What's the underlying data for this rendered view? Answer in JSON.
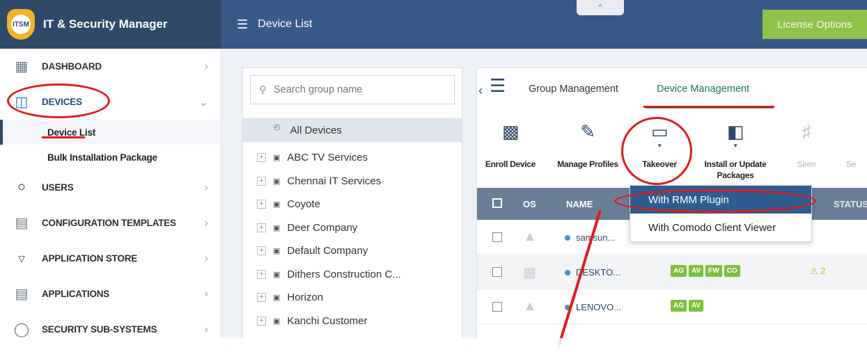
{
  "app": {
    "logo_text": "ITSM",
    "title": "IT & Security Manager",
    "page_title": "Device List",
    "collapse_glyph": "^",
    "license_button": "License Options"
  },
  "sidebar": {
    "items": [
      {
        "label": "DASHBOARD",
        "icon": "dashboard-grid-icon"
      },
      {
        "label": "DEVICES",
        "icon": "devices-icon"
      },
      {
        "label": "USERS",
        "icon": "user-icon"
      },
      {
        "label": "CONFIGURATION TEMPLATES",
        "icon": "templates-icon"
      },
      {
        "label": "APPLICATION STORE",
        "icon": "store-basket-icon"
      },
      {
        "label": "APPLICATIONS",
        "icon": "applications-icon"
      },
      {
        "label": "SECURITY SUB-SYSTEMS",
        "icon": "shield-icon"
      }
    ],
    "sub_items": [
      {
        "label": "Device List"
      },
      {
        "label": "Bulk Installation Package"
      }
    ]
  },
  "groups": {
    "search_placeholder": "Search group name",
    "all_devices": "All Devices",
    "list": [
      "ABC TV Services",
      "Chennai IT Services",
      "Coyote",
      "Deer Company",
      "Default Company",
      "Dithers Construction C...",
      "Horizon",
      "Kanchi Customer"
    ]
  },
  "tabs": {
    "group_management": "Group Management",
    "device_management": "Device Management"
  },
  "toolbar": {
    "enroll": "Enroll Device",
    "manage_profiles": "Manage Profiles",
    "takeover": "Takeover",
    "install_update_line1": "Install or Update",
    "install_update_line2": "Packages",
    "siren": "Siren",
    "clipped": "Se"
  },
  "table": {
    "headers": {
      "os": "OS",
      "name": "NAME",
      "status": "STATUS"
    },
    "rows": [
      {
        "os": "android",
        "name": "samsun...",
        "badges": [],
        "warning": ""
      },
      {
        "os": "windows",
        "name": "DESKTO...",
        "badges": [
          "AG",
          "AV",
          "FW",
          "CO"
        ],
        "warning": "2"
      },
      {
        "os": "android",
        "name": "LENOVO...",
        "badges": [
          "AG",
          "AV"
        ],
        "warning": ""
      }
    ]
  },
  "takeover_menu": {
    "options": [
      "With RMM Plugin",
      "With Comodo Client Viewer"
    ],
    "selected": "With RMM Plugin"
  },
  "colors": {
    "header_dark": "#2f4969",
    "header": "#365b86",
    "accent_green": "#8ec24a",
    "annotation_red": "#e01b1b",
    "table_header": "#6a7f97"
  }
}
